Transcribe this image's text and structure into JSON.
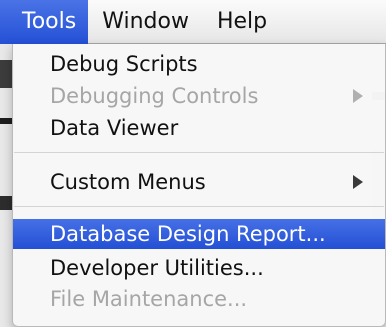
{
  "menubar": {
    "items": [
      {
        "label": "Tools"
      },
      {
        "label": "Window"
      },
      {
        "label": "Help"
      }
    ]
  },
  "menu": {
    "items": [
      {
        "label": "Debug Scripts",
        "state": "enabled"
      },
      {
        "label": "Debugging Controls",
        "state": "disabled",
        "has_submenu": true
      },
      {
        "label": "Data Viewer",
        "state": "enabled"
      },
      {
        "label": "Custom Menus",
        "state": "enabled",
        "has_submenu": true
      },
      {
        "label": "Database Design Report...",
        "state": "highlighted"
      },
      {
        "label": "Developer Utilities...",
        "state": "enabled"
      },
      {
        "label": "File Maintenance...",
        "state": "disabled"
      }
    ]
  },
  "colors": {
    "highlight": "#2f5ddc",
    "disabled_text": "#a6a6a6",
    "menu_background": "#f7f7f7"
  }
}
